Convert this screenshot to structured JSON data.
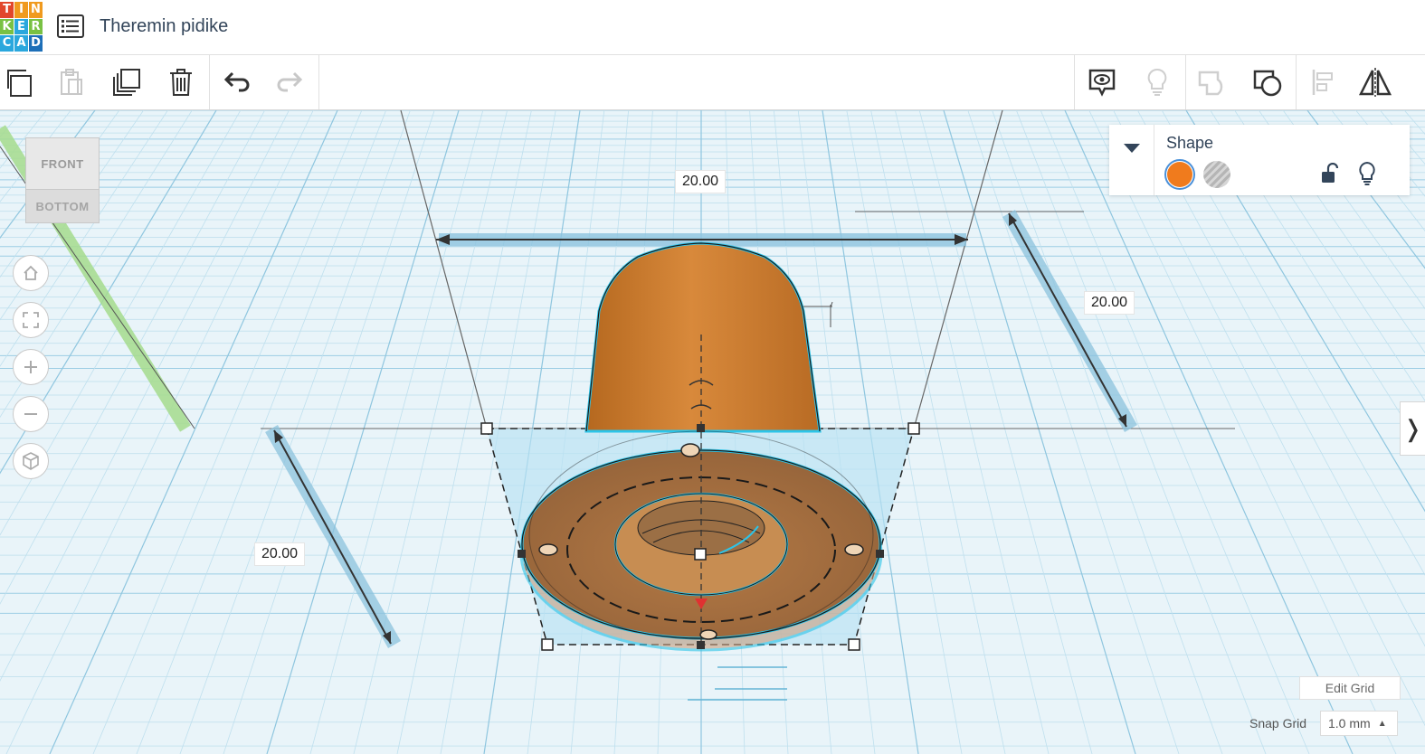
{
  "app": {
    "logo_letters": [
      "T",
      "I",
      "N",
      "K",
      "E",
      "R",
      "C",
      "A",
      "D"
    ],
    "logo_colors": [
      "#e2462b",
      "#f09a1e",
      "#f09a1e",
      "#79c143",
      "#2aa7dd",
      "#79c143",
      "#2aa7dd",
      "#2aa7dd",
      "#1d6fb8"
    ],
    "title": "Theremin pidike"
  },
  "toolbar": {
    "left_icons": [
      "copy-icon",
      "paste-icon",
      "duplicate-icon",
      "trash-icon",
      "undo-icon",
      "redo-icon"
    ],
    "right_icons": [
      "note-icon",
      "lightbulb-icon",
      "group-icon",
      "ungroup-icon",
      "align-icon",
      "mirror-icon"
    ]
  },
  "viewcube": {
    "top_label": "FRONT",
    "bottom_label": "BOTTOM"
  },
  "nav": [
    "home-icon",
    "fit-view-icon",
    "zoom-in-icon",
    "zoom-out-icon",
    "perspective-icon"
  ],
  "dimensions": {
    "top": "20.00",
    "right": "20.00",
    "left": "20.00"
  },
  "shape_panel": {
    "title": "Shape",
    "solid_color": "#f07b1d"
  },
  "footer": {
    "edit_grid": "Edit Grid",
    "snap_label": "Snap Grid",
    "snap_value": "1.0 mm"
  },
  "colors": {
    "accent": "#2cc4e8",
    "orange": "#c97a32",
    "grid_bg": "#e9f4f9"
  }
}
